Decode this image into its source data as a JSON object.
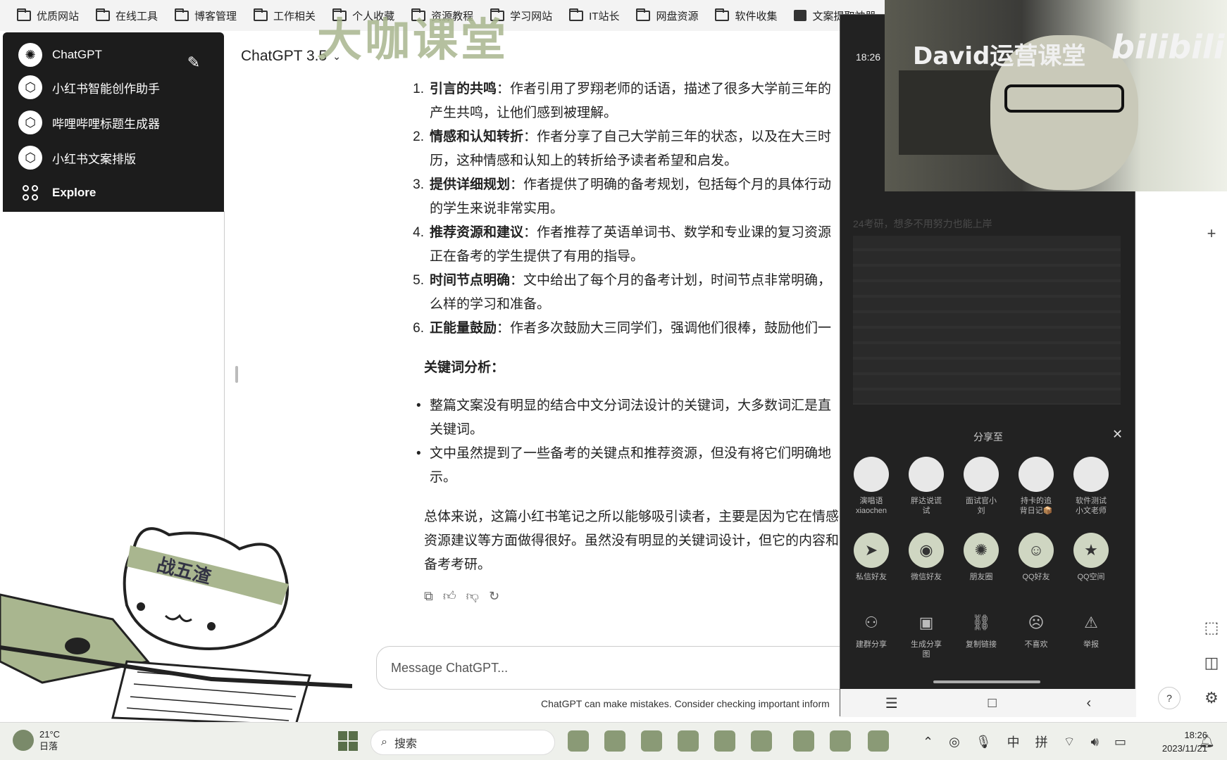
{
  "bookmarks": [
    {
      "label": "优质网站",
      "icon": "folder-icon"
    },
    {
      "label": "在线工具",
      "icon": "folder-icon"
    },
    {
      "label": "博客管理",
      "icon": "folder-icon"
    },
    {
      "label": "工作相关",
      "icon": "folder-icon"
    },
    {
      "label": "个人收藏",
      "icon": "folder-icon"
    },
    {
      "label": "资源教程",
      "icon": "folder-icon"
    },
    {
      "label": "学习网站",
      "icon": "folder-icon"
    },
    {
      "label": "IT站长",
      "icon": "folder-icon"
    },
    {
      "label": "网盘资源",
      "icon": "folder-icon"
    },
    {
      "label": "软件收集",
      "icon": "folder-icon"
    },
    {
      "label": "文案提取神器",
      "icon": "app-icon"
    }
  ],
  "watermark": "大咖课堂",
  "sidebar": {
    "items": [
      {
        "label": "ChatGPT",
        "icon": "openai-logo-icon"
      },
      {
        "label": "小红书智能创作助手",
        "icon": "gpt-cube-icon"
      },
      {
        "label": "哔哩哔哩标题生成器",
        "icon": "gpt-cube-icon"
      },
      {
        "label": "小红书文案排版",
        "icon": "gpt-cube-icon"
      },
      {
        "label": "Explore",
        "icon": "explore-grid-icon"
      }
    ]
  },
  "header": {
    "model": "ChatGPT 3.5"
  },
  "chat": {
    "ordered": [
      {
        "num": "1.",
        "title": "引言的共鸣",
        "line1": "：作者引用了罗翔老师的话语，描述了很多大学前三年的",
        "line2": "产生共鸣，让他们感到被理解。"
      },
      {
        "num": "2.",
        "title": "情感和认知转折",
        "line1": "：作者分享了自己大学前三年的状态，以及在大三时",
        "line2": "历，这种情感和认知上的转折给予读者希望和启发。"
      },
      {
        "num": "3.",
        "title": "提供详细规划",
        "line1": "：作者提供了明确的备考规划，包括每个月的具体行动",
        "line2": "的学生来说非常实用。"
      },
      {
        "num": "4.",
        "title": "推荐资源和建议",
        "line1": "：作者推荐了英语单词书、数学和专业课的复习资源",
        "line2": "正在备考的学生提供了有用的指导。"
      },
      {
        "num": "5.",
        "title": "时间节点明确",
        "line1": "：文中给出了每个月的备考计划，时间节点非常明确，",
        "line2": "么样的学习和准备。"
      },
      {
        "num": "6.",
        "title": "正能量鼓励",
        "line1": "：作者多次鼓励大三同学们，强调他们很棒，鼓励他们一",
        "line2": ""
      }
    ],
    "keyword_heading": "关键词分析：",
    "bullets": [
      {
        "line1": "整篇文案没有明显的结合中文分词法设计的关键词，大多数词汇是直",
        "line2": "关键词。"
      },
      {
        "line1": "文中虽然提到了一些备考的关键点和推荐资源，但没有将它们明确地",
        "line2": "示。"
      }
    ],
    "summary": [
      "总体来说，这篇小红书笔记之所以能够吸引读者，主要是因为它在情感",
      "资源建议等方面做得很好。虽然没有明显的关键词设计，但它的内容和",
      "备考考研。"
    ]
  },
  "composer": {
    "placeholder": "Message ChatGPT...",
    "disclaimer": "ChatGPT can make mistakes. Consider checking important inform"
  },
  "mascot": {
    "headband": "战五渣"
  },
  "phone": {
    "time": "18:26",
    "bg_title": "24考研，想多不用努力也能上岸",
    "share_title": "分享至",
    "contacts": [
      {
        "label": "演唱语\nxiaochen"
      },
      {
        "label": "胖达说谎\n试"
      },
      {
        "label": "面试官小\n刘"
      },
      {
        "label": "持卡的追\n背日记📦"
      },
      {
        "label": "软件测试\n小文老师"
      }
    ],
    "apps": [
      {
        "label": "私信好友",
        "icon": "send-icon"
      },
      {
        "label": "微信好友",
        "icon": "wechat-icon"
      },
      {
        "label": "朋友圈",
        "icon": "moments-icon"
      },
      {
        "label": "QQ好友",
        "icon": "qq-icon"
      },
      {
        "label": "QQ空间",
        "icon": "qzone-icon"
      }
    ],
    "tools": [
      {
        "label": "建群分享",
        "icon": "group-icon"
      },
      {
        "label": "生成分享\n图",
        "icon": "image-icon"
      },
      {
        "label": "复制链接",
        "icon": "link-icon"
      },
      {
        "label": "不喜欢",
        "icon": "dislike-icon"
      },
      {
        "label": "举报",
        "icon": "report-icon"
      }
    ]
  },
  "webcam": {
    "overlay": "David运营课堂",
    "logo": "bilibili"
  },
  "taskbar": {
    "temp": "21°C",
    "weather": "日落",
    "search": "搜索",
    "ime1": "中",
    "ime2": "拼",
    "time": "18:26",
    "date": "2023/11/21"
  }
}
